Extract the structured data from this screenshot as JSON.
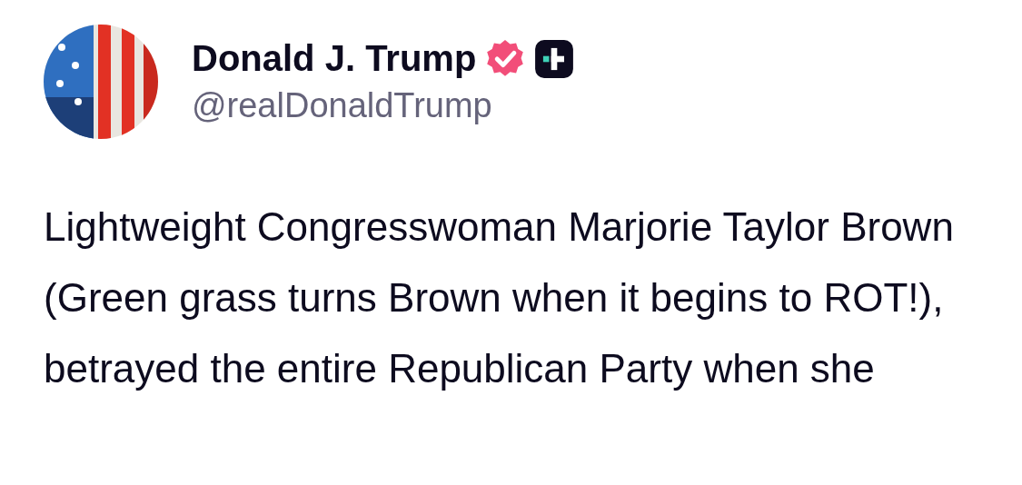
{
  "post": {
    "author": {
      "name": "Donald J. Trump",
      "verified": true,
      "handle": "@realDonaldTrump"
    },
    "text": "Lightweight Congresswoman Marjorie Taylor Brown (Green grass turns Brown when it begins to ROT!), betrayed the entire Republican Party when she"
  }
}
